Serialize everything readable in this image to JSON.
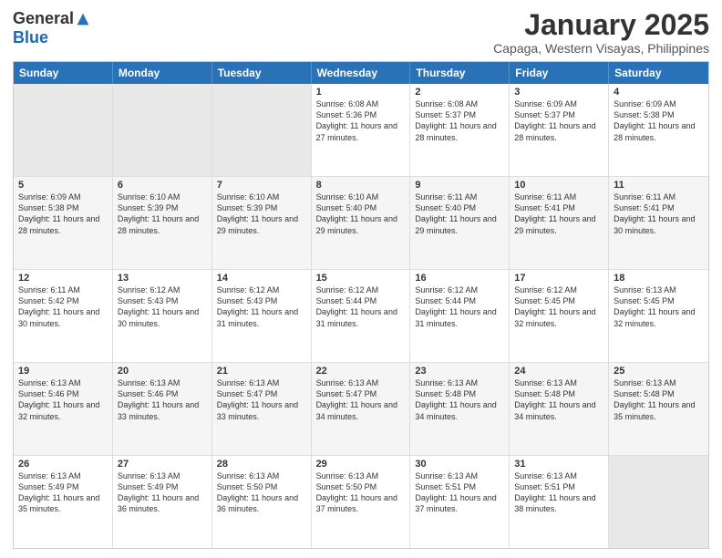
{
  "logo": {
    "general": "General",
    "blue": "Blue"
  },
  "title": "January 2025",
  "subtitle": "Capaga, Western Visayas, Philippines",
  "days": [
    "Sunday",
    "Monday",
    "Tuesday",
    "Wednesday",
    "Thursday",
    "Friday",
    "Saturday"
  ],
  "rows": [
    [
      {
        "day": "",
        "sunrise": "",
        "sunset": "",
        "daylight": "",
        "empty": true
      },
      {
        "day": "",
        "sunrise": "",
        "sunset": "",
        "daylight": "",
        "empty": true
      },
      {
        "day": "",
        "sunrise": "",
        "sunset": "",
        "daylight": "",
        "empty": true
      },
      {
        "day": "1",
        "sunrise": "Sunrise: 6:08 AM",
        "sunset": "Sunset: 5:36 PM",
        "daylight": "Daylight: 11 hours and 27 minutes.",
        "empty": false
      },
      {
        "day": "2",
        "sunrise": "Sunrise: 6:08 AM",
        "sunset": "Sunset: 5:37 PM",
        "daylight": "Daylight: 11 hours and 28 minutes.",
        "empty": false
      },
      {
        "day": "3",
        "sunrise": "Sunrise: 6:09 AM",
        "sunset": "Sunset: 5:37 PM",
        "daylight": "Daylight: 11 hours and 28 minutes.",
        "empty": false
      },
      {
        "day": "4",
        "sunrise": "Sunrise: 6:09 AM",
        "sunset": "Sunset: 5:38 PM",
        "daylight": "Daylight: 11 hours and 28 minutes.",
        "empty": false
      }
    ],
    [
      {
        "day": "5",
        "sunrise": "Sunrise: 6:09 AM",
        "sunset": "Sunset: 5:38 PM",
        "daylight": "Daylight: 11 hours and 28 minutes.",
        "empty": false
      },
      {
        "day": "6",
        "sunrise": "Sunrise: 6:10 AM",
        "sunset": "Sunset: 5:39 PM",
        "daylight": "Daylight: 11 hours and 28 minutes.",
        "empty": false
      },
      {
        "day": "7",
        "sunrise": "Sunrise: 6:10 AM",
        "sunset": "Sunset: 5:39 PM",
        "daylight": "Daylight: 11 hours and 29 minutes.",
        "empty": false
      },
      {
        "day": "8",
        "sunrise": "Sunrise: 6:10 AM",
        "sunset": "Sunset: 5:40 PM",
        "daylight": "Daylight: 11 hours and 29 minutes.",
        "empty": false
      },
      {
        "day": "9",
        "sunrise": "Sunrise: 6:11 AM",
        "sunset": "Sunset: 5:40 PM",
        "daylight": "Daylight: 11 hours and 29 minutes.",
        "empty": false
      },
      {
        "day": "10",
        "sunrise": "Sunrise: 6:11 AM",
        "sunset": "Sunset: 5:41 PM",
        "daylight": "Daylight: 11 hours and 29 minutes.",
        "empty": false
      },
      {
        "day": "11",
        "sunrise": "Sunrise: 6:11 AM",
        "sunset": "Sunset: 5:41 PM",
        "daylight": "Daylight: 11 hours and 30 minutes.",
        "empty": false
      }
    ],
    [
      {
        "day": "12",
        "sunrise": "Sunrise: 6:11 AM",
        "sunset": "Sunset: 5:42 PM",
        "daylight": "Daylight: 11 hours and 30 minutes.",
        "empty": false
      },
      {
        "day": "13",
        "sunrise": "Sunrise: 6:12 AM",
        "sunset": "Sunset: 5:43 PM",
        "daylight": "Daylight: 11 hours and 30 minutes.",
        "empty": false
      },
      {
        "day": "14",
        "sunrise": "Sunrise: 6:12 AM",
        "sunset": "Sunset: 5:43 PM",
        "daylight": "Daylight: 11 hours and 31 minutes.",
        "empty": false
      },
      {
        "day": "15",
        "sunrise": "Sunrise: 6:12 AM",
        "sunset": "Sunset: 5:44 PM",
        "daylight": "Daylight: 11 hours and 31 minutes.",
        "empty": false
      },
      {
        "day": "16",
        "sunrise": "Sunrise: 6:12 AM",
        "sunset": "Sunset: 5:44 PM",
        "daylight": "Daylight: 11 hours and 31 minutes.",
        "empty": false
      },
      {
        "day": "17",
        "sunrise": "Sunrise: 6:12 AM",
        "sunset": "Sunset: 5:45 PM",
        "daylight": "Daylight: 11 hours and 32 minutes.",
        "empty": false
      },
      {
        "day": "18",
        "sunrise": "Sunrise: 6:13 AM",
        "sunset": "Sunset: 5:45 PM",
        "daylight": "Daylight: 11 hours and 32 minutes.",
        "empty": false
      }
    ],
    [
      {
        "day": "19",
        "sunrise": "Sunrise: 6:13 AM",
        "sunset": "Sunset: 5:46 PM",
        "daylight": "Daylight: 11 hours and 32 minutes.",
        "empty": false
      },
      {
        "day": "20",
        "sunrise": "Sunrise: 6:13 AM",
        "sunset": "Sunset: 5:46 PM",
        "daylight": "Daylight: 11 hours and 33 minutes.",
        "empty": false
      },
      {
        "day": "21",
        "sunrise": "Sunrise: 6:13 AM",
        "sunset": "Sunset: 5:47 PM",
        "daylight": "Daylight: 11 hours and 33 minutes.",
        "empty": false
      },
      {
        "day": "22",
        "sunrise": "Sunrise: 6:13 AM",
        "sunset": "Sunset: 5:47 PM",
        "daylight": "Daylight: 11 hours and 34 minutes.",
        "empty": false
      },
      {
        "day": "23",
        "sunrise": "Sunrise: 6:13 AM",
        "sunset": "Sunset: 5:48 PM",
        "daylight": "Daylight: 11 hours and 34 minutes.",
        "empty": false
      },
      {
        "day": "24",
        "sunrise": "Sunrise: 6:13 AM",
        "sunset": "Sunset: 5:48 PM",
        "daylight": "Daylight: 11 hours and 34 minutes.",
        "empty": false
      },
      {
        "day": "25",
        "sunrise": "Sunrise: 6:13 AM",
        "sunset": "Sunset: 5:48 PM",
        "daylight": "Daylight: 11 hours and 35 minutes.",
        "empty": false
      }
    ],
    [
      {
        "day": "26",
        "sunrise": "Sunrise: 6:13 AM",
        "sunset": "Sunset: 5:49 PM",
        "daylight": "Daylight: 11 hours and 35 minutes.",
        "empty": false
      },
      {
        "day": "27",
        "sunrise": "Sunrise: 6:13 AM",
        "sunset": "Sunset: 5:49 PM",
        "daylight": "Daylight: 11 hours and 36 minutes.",
        "empty": false
      },
      {
        "day": "28",
        "sunrise": "Sunrise: 6:13 AM",
        "sunset": "Sunset: 5:50 PM",
        "daylight": "Daylight: 11 hours and 36 minutes.",
        "empty": false
      },
      {
        "day": "29",
        "sunrise": "Sunrise: 6:13 AM",
        "sunset": "Sunset: 5:50 PM",
        "daylight": "Daylight: 11 hours and 37 minutes.",
        "empty": false
      },
      {
        "day": "30",
        "sunrise": "Sunrise: 6:13 AM",
        "sunset": "Sunset: 5:51 PM",
        "daylight": "Daylight: 11 hours and 37 minutes.",
        "empty": false
      },
      {
        "day": "31",
        "sunrise": "Sunrise: 6:13 AM",
        "sunset": "Sunset: 5:51 PM",
        "daylight": "Daylight: 11 hours and 38 minutes.",
        "empty": false
      },
      {
        "day": "",
        "sunrise": "",
        "sunset": "",
        "daylight": "",
        "empty": true
      }
    ]
  ]
}
